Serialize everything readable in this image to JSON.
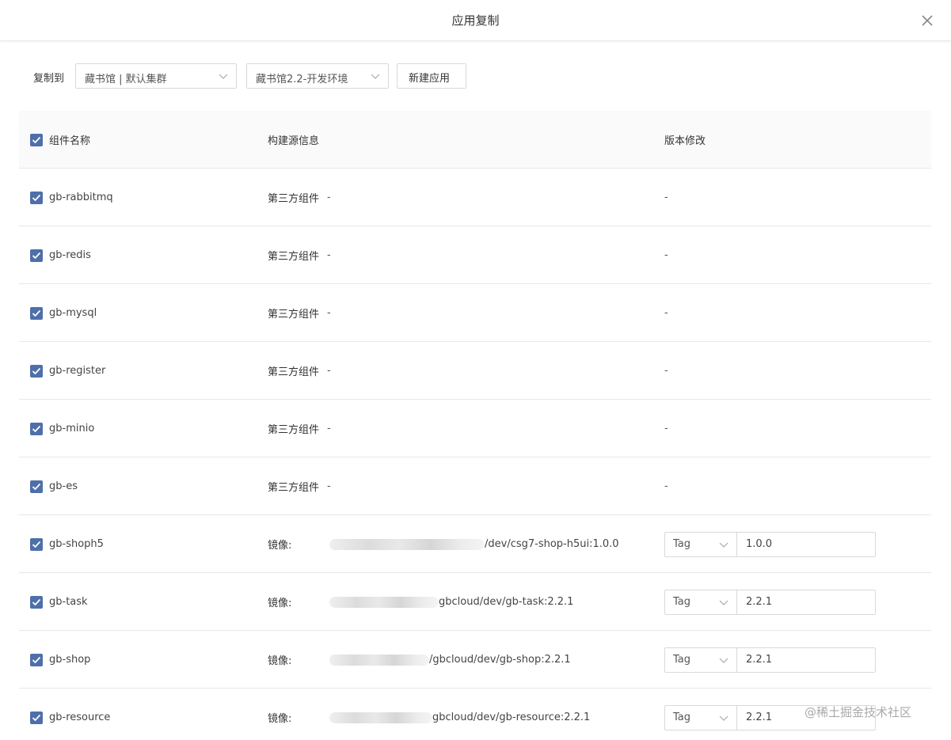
{
  "dialog": {
    "title": "应用复制"
  },
  "toolbar": {
    "label": "复制到",
    "cluster_select": "藏书馆 | 默认集群",
    "env_select": "藏书馆2.2-开发环境",
    "new_app_button": "新建应用"
  },
  "table": {
    "headers": {
      "name": "组件名称",
      "source": "构建源信息",
      "version": "版本修改"
    },
    "rows": [
      {
        "name": "gb-rabbitmq",
        "source_type": "第三方组件",
        "source_value": "-",
        "version": "-"
      },
      {
        "name": "gb-redis",
        "source_type": "第三方组件",
        "source_value": "-",
        "version": "-"
      },
      {
        "name": "gb-mysql",
        "source_type": "第三方组件",
        "source_value": "-",
        "version": "-"
      },
      {
        "name": "gb-register",
        "source_type": "第三方组件",
        "source_value": "-",
        "version": "-"
      },
      {
        "name": "gb-minio",
        "source_type": "第三方组件",
        "source_value": "-",
        "version": "-"
      },
      {
        "name": "gb-es",
        "source_type": "第三方组件",
        "source_value": "-",
        "version": "-"
      },
      {
        "name": "gb-shoph5",
        "source_type": "镜像:",
        "image_path": "/dev/csg7-shop-h5ui:1.0.0",
        "tag_type": "Tag",
        "tag_value": "1.0.0"
      },
      {
        "name": "gb-task",
        "source_type": "镜像:",
        "image_path": "gbcloud/dev/gb-task:2.2.1",
        "tag_type": "Tag",
        "tag_value": "2.2.1"
      },
      {
        "name": "gb-shop",
        "source_type": "镜像:",
        "image_path": "/gbcloud/dev/gb-shop:2.2.1",
        "tag_type": "Tag",
        "tag_value": "2.2.1"
      },
      {
        "name": "gb-resource",
        "source_type": "镜像:",
        "image_path": "gbcloud/dev/gb-resource:2.2.1",
        "tag_type": "Tag",
        "tag_value": "2.2.1"
      }
    ]
  },
  "watermark": "@稀土掘金技术社区",
  "colors": {
    "checkbox": "#4e6faa",
    "border": "#d9d9d9",
    "header_bg": "#fafafa"
  }
}
